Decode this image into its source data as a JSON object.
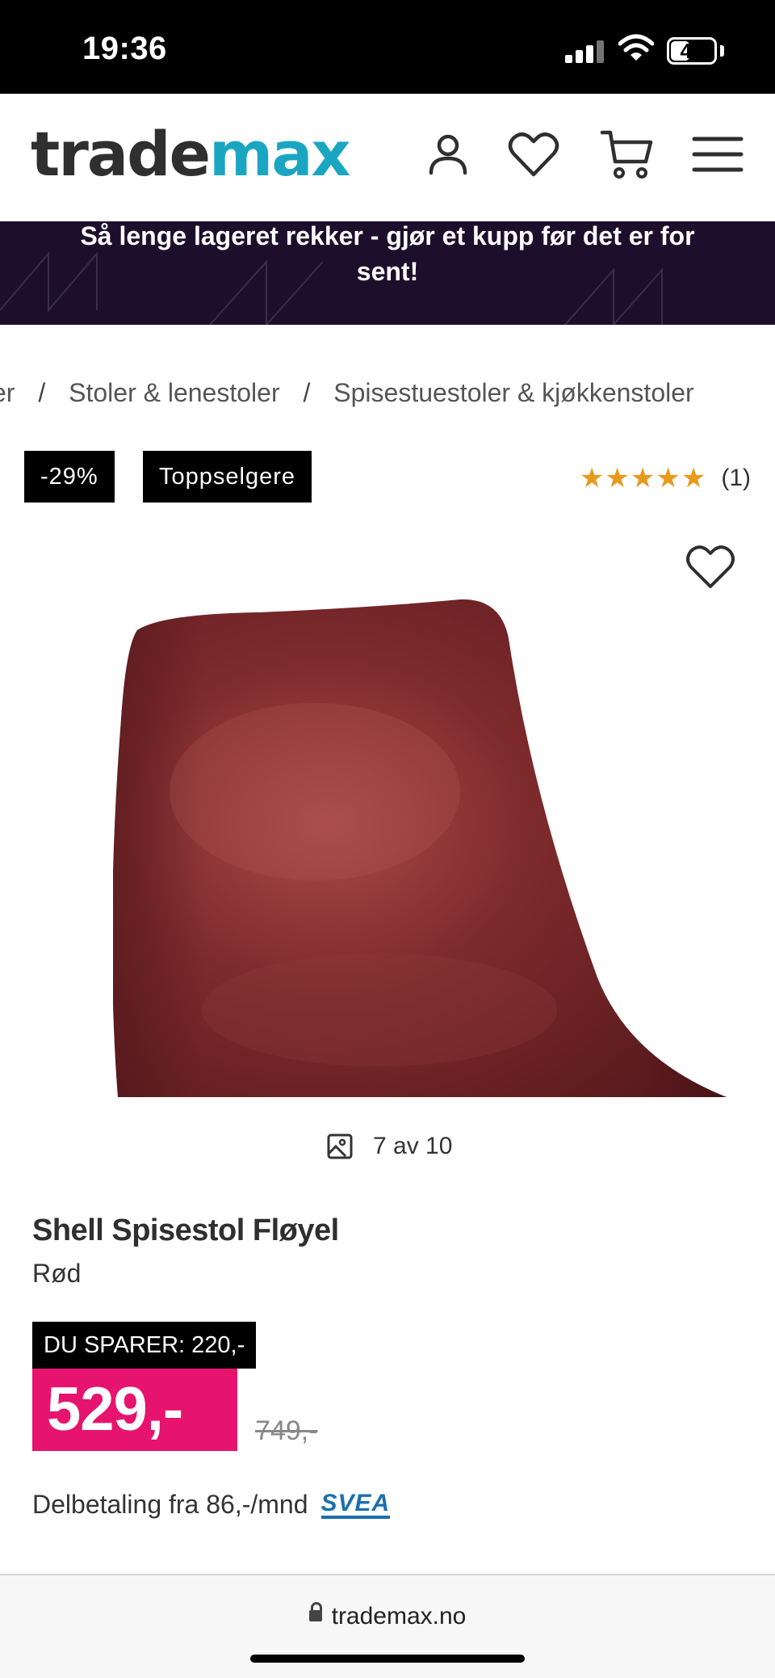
{
  "status_bar": {
    "time": "19:36",
    "battery": "48",
    "battery_level": 0.48
  },
  "header": {
    "logo_part1": "trade",
    "logo_part2": "max",
    "icons": [
      "user-icon",
      "heart-icon",
      "cart-icon",
      "menu-icon"
    ]
  },
  "banner": {
    "text": "Så lenge lageret rekker - gjør et kupp før det er for sent!"
  },
  "breadcrumb": {
    "items": [
      "er",
      "Stoler & lenestoler",
      "Spisestuestoler & kjøkkenstoler"
    ],
    "separator": "/"
  },
  "badges": {
    "discount": "-29%",
    "bestseller": "Toppselgere"
  },
  "rating": {
    "stars": 5,
    "count": "(1)"
  },
  "gallery": {
    "counter": "7 av 10"
  },
  "product": {
    "title": "Shell Spisestol Fløyel",
    "variant": "Rød",
    "save_label": "DU SPARER: 220,-",
    "price": "529,-",
    "old_price": "749,-",
    "installment": "Delbetaling fra 86,-/mnd",
    "installment_provider": "SVEA"
  },
  "browser": {
    "url": "trademax.no"
  },
  "colors": {
    "accent": "#1aa6c0",
    "price_bg": "#e6146e",
    "banner_bg": "#1d0f2c",
    "star": "#e89a1c"
  }
}
